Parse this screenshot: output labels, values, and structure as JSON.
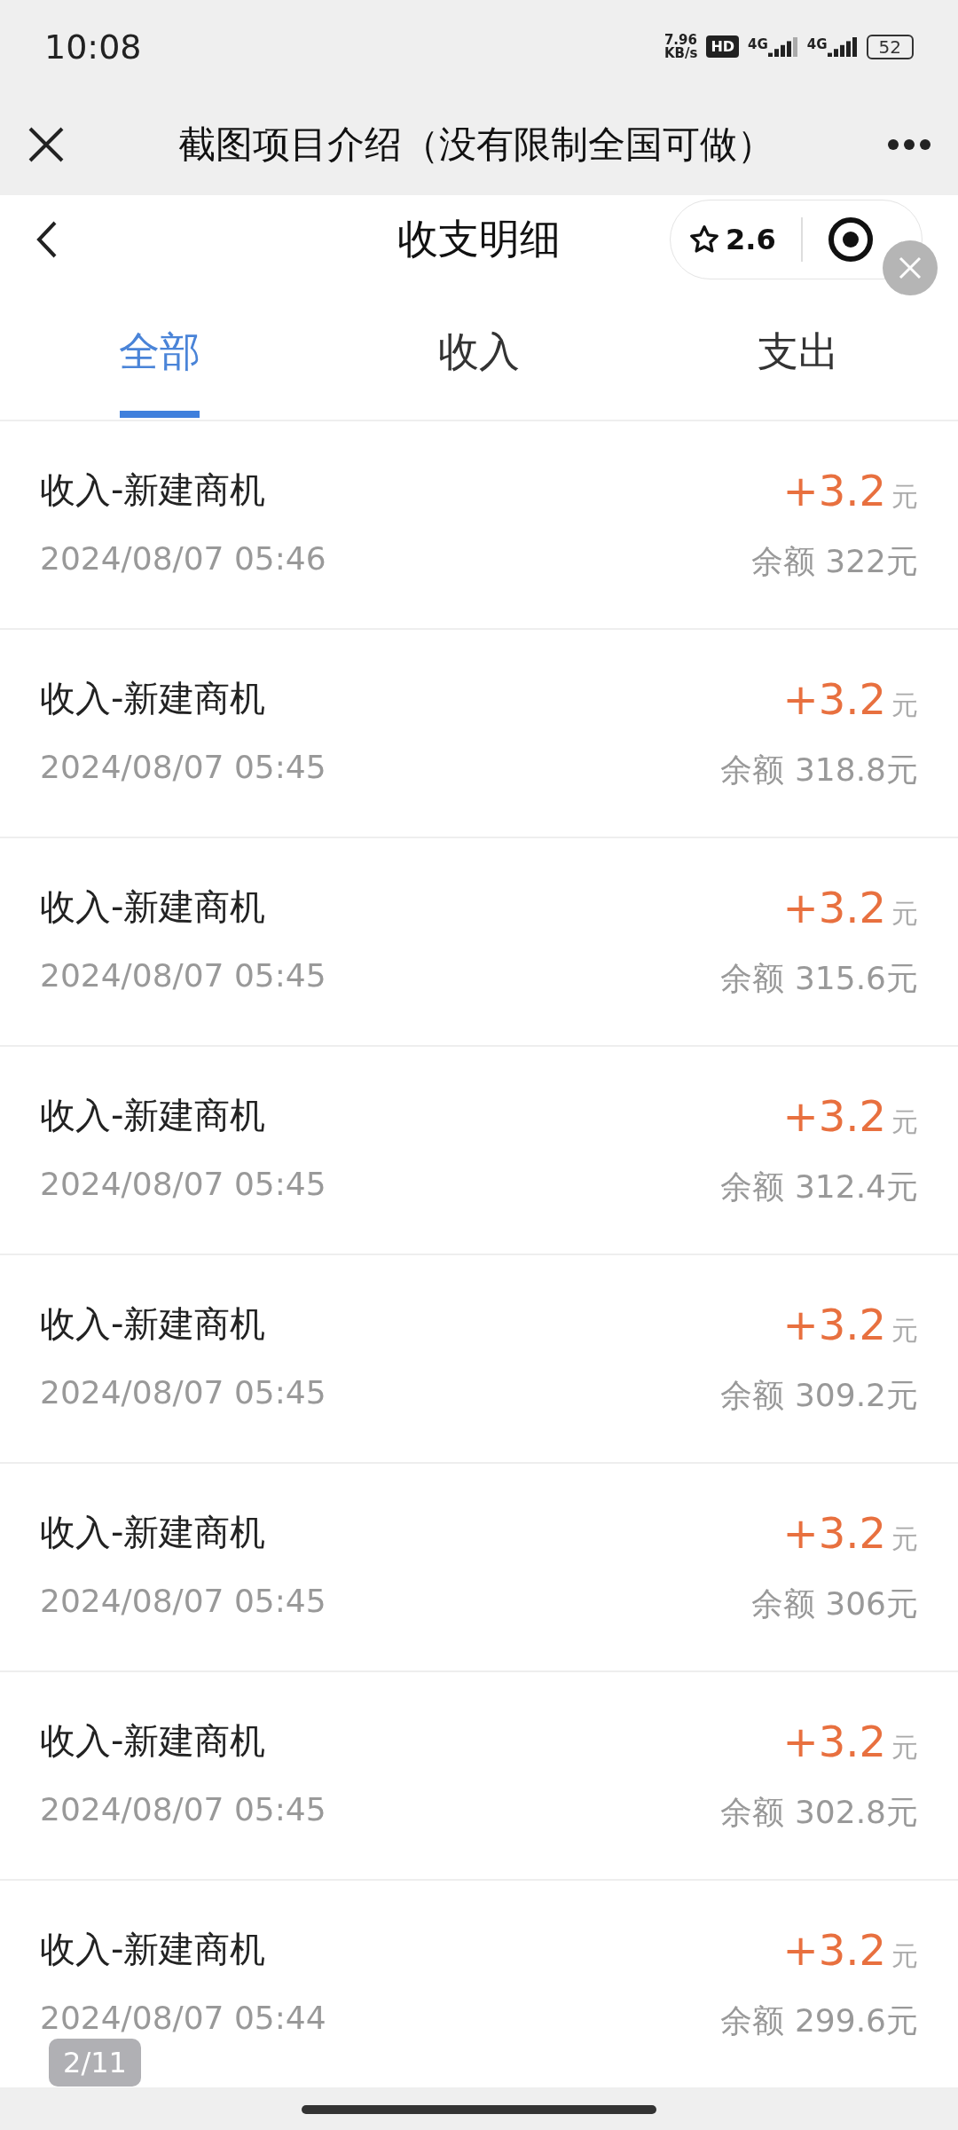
{
  "status_bar": {
    "time": "10:08",
    "speed_value": "7.96",
    "speed_unit": "KB/s",
    "hd_badge": "HD",
    "sim_labels": [
      "4G",
      "4G"
    ],
    "battery": "52"
  },
  "nav_bar": {
    "title": "截图项目介绍（没有限制全国可做）"
  },
  "header": {
    "title": "收支明细",
    "rating": "2.6"
  },
  "tabs": [
    {
      "label": "全部",
      "selected": true
    },
    {
      "label": "收入",
      "selected": false
    },
    {
      "label": "支出",
      "selected": false
    }
  ],
  "records": [
    {
      "title": "收入-新建商机",
      "time": "2024/08/07 05:46",
      "amount": "+3.2",
      "unit": "元",
      "balance": "余额 322元"
    },
    {
      "title": "收入-新建商机",
      "time": "2024/08/07 05:45",
      "amount": "+3.2",
      "unit": "元",
      "balance": "余额 318.8元"
    },
    {
      "title": "收入-新建商机",
      "time": "2024/08/07 05:45",
      "amount": "+3.2",
      "unit": "元",
      "balance": "余额 315.6元"
    },
    {
      "title": "收入-新建商机",
      "time": "2024/08/07 05:45",
      "amount": "+3.2",
      "unit": "元",
      "balance": "余额 312.4元"
    },
    {
      "title": "收入-新建商机",
      "time": "2024/08/07 05:45",
      "amount": "+3.2",
      "unit": "元",
      "balance": "余额 309.2元"
    },
    {
      "title": "收入-新建商机",
      "time": "2024/08/07 05:45",
      "amount": "+3.2",
      "unit": "元",
      "balance": "余额 306元"
    },
    {
      "title": "收入-新建商机",
      "time": "2024/08/07 05:45",
      "amount": "+3.2",
      "unit": "元",
      "balance": "余额 302.8元"
    },
    {
      "title": "收入-新建商机",
      "time": "2024/08/07 05:44",
      "amount": "+3.2",
      "unit": "元",
      "balance": "余额 299.6元"
    }
  ],
  "page_indicator": "2/11"
}
